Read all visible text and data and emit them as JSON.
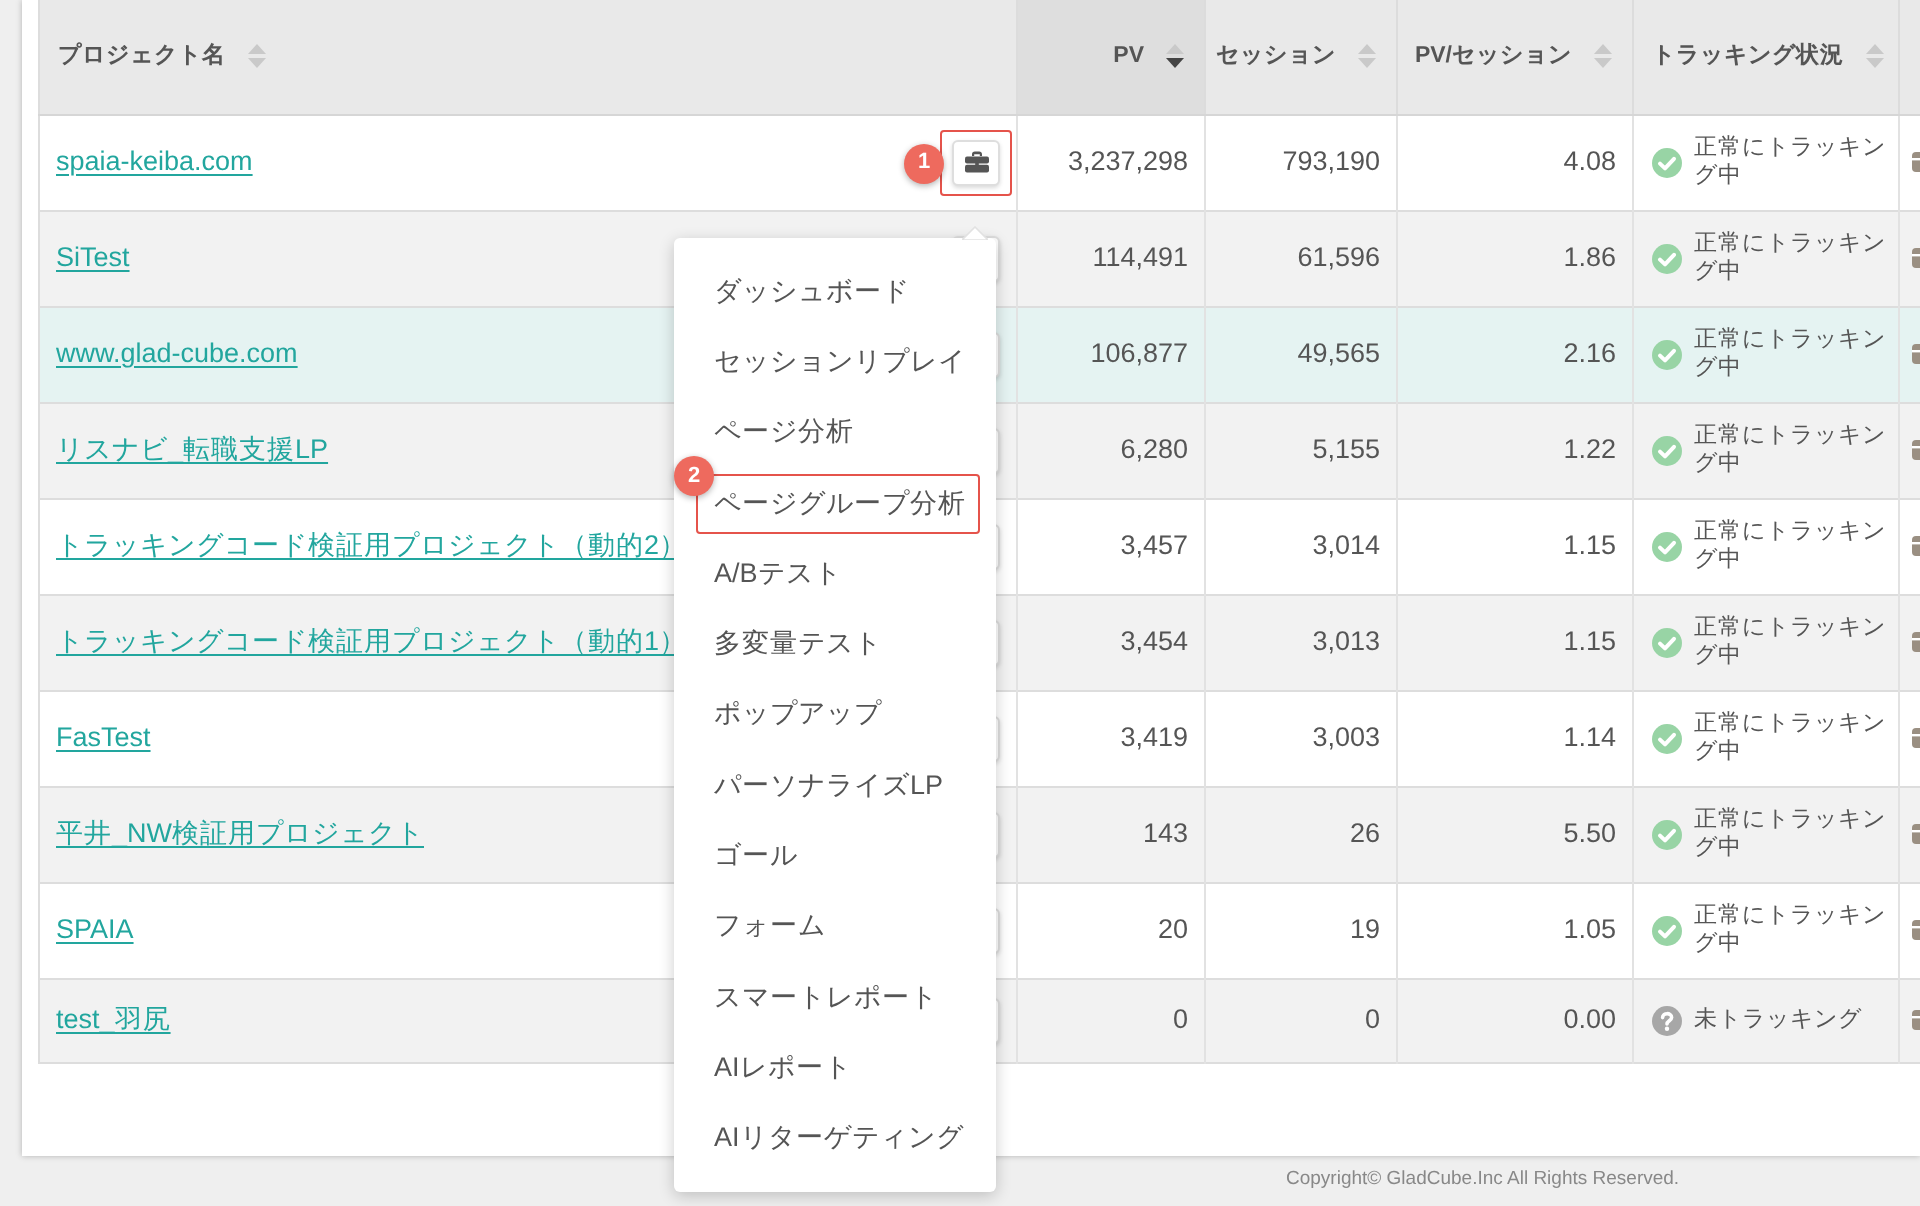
{
  "table": {
    "columns": [
      {
        "label": "プロジェクト名",
        "kind": "text",
        "sorted_ascending": false,
        "sorted_descending": false
      },
      {
        "label": "PV",
        "kind": "number",
        "sorted_ascending": false,
        "sorted_descending": true
      },
      {
        "label": "セッション",
        "kind": "number",
        "sorted_ascending": false,
        "sorted_descending": false
      },
      {
        "label": "PV/セッション",
        "kind": "number",
        "sorted_ascending": false,
        "sorted_descending": false
      },
      {
        "label": "トラッキング状況",
        "kind": "status",
        "sorted_ascending": false,
        "sorted_descending": false
      }
    ],
    "rows": [
      {
        "name": "spaia-keiba.com",
        "pv": "3,237,298",
        "sessions": "793,190",
        "pv_per_session": "4.08",
        "status": {
          "kind": "tracking",
          "label": "正常にトラッキング中"
        },
        "highlighted": false,
        "callout": "1"
      },
      {
        "name": "SiTest",
        "pv": "114,491",
        "sessions": "61,596",
        "pv_per_session": "1.86",
        "status": {
          "kind": "tracking",
          "label": "正常にトラッキング中"
        },
        "highlighted": false
      },
      {
        "name": "www.glad-cube.com",
        "pv": "106,877",
        "sessions": "49,565",
        "pv_per_session": "2.16",
        "status": {
          "kind": "tracking",
          "label": "正常にトラッキング中"
        },
        "highlighted": true
      },
      {
        "name": "リスナビ_転職支援LP",
        "pv": "6,280",
        "sessions": "5,155",
        "pv_per_session": "1.22",
        "status": {
          "kind": "tracking",
          "label": "正常にトラッキング中"
        },
        "highlighted": false
      },
      {
        "name": "トラッキングコード検証用プロジェクト（動的2）",
        "pv": "3,457",
        "sessions": "3,014",
        "pv_per_session": "1.15",
        "status": {
          "kind": "tracking",
          "label": "正常にトラッキング中"
        },
        "highlighted": false
      },
      {
        "name": "トラッキングコード検証用プロジェクト（動的1）",
        "pv": "3,454",
        "sessions": "3,013",
        "pv_per_session": "1.15",
        "status": {
          "kind": "tracking",
          "label": "正常にトラッキング中"
        },
        "highlighted": false
      },
      {
        "name": "FasTest",
        "pv": "3,419",
        "sessions": "3,003",
        "pv_per_session": "1.14",
        "status": {
          "kind": "tracking",
          "label": "正常にトラッキング中"
        },
        "highlighted": false
      },
      {
        "name": "平井_NW検証用プロジェクト",
        "pv": "143",
        "sessions": "26",
        "pv_per_session": "5.50",
        "status": {
          "kind": "tracking",
          "label": "正常にトラッキング中"
        },
        "highlighted": false
      },
      {
        "name": "SPAIA",
        "pv": "20",
        "sessions": "19",
        "pv_per_session": "1.05",
        "status": {
          "kind": "tracking",
          "label": "正常にトラッキング中"
        },
        "highlighted": false
      },
      {
        "name": "test_羽尻",
        "pv": "0",
        "sessions": "0",
        "pv_per_session": "0.00",
        "status": {
          "kind": "not_tracking",
          "label": "未トラッキング"
        },
        "highlighted": false
      }
    ]
  },
  "menu": {
    "items": [
      {
        "label": "ダッシュボード"
      },
      {
        "label": "セッションリプレイ"
      },
      {
        "label": "ページ分析"
      },
      {
        "label": "ページグループ分析",
        "callout": "2"
      },
      {
        "label": "A/Bテスト"
      },
      {
        "label": "多変量テスト"
      },
      {
        "label": "ポップアップ"
      },
      {
        "label": "パーソナライズLP"
      },
      {
        "label": "ゴール"
      },
      {
        "label": "フォーム"
      },
      {
        "label": "スマートレポート"
      },
      {
        "label": "AIレポート"
      },
      {
        "label": "AIリターゲティング"
      }
    ]
  },
  "footer": {
    "copyright": "Copyright© GladCube.Inc All Rights Reserved."
  }
}
